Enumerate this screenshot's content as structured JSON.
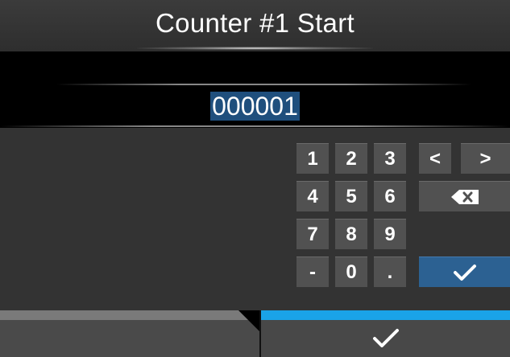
{
  "header": {
    "title": "Counter #1 Start"
  },
  "value": {
    "current": "000001"
  },
  "keypad": {
    "keys": {
      "k1": "1",
      "k2": "2",
      "k3": "3",
      "k4": "4",
      "k5": "5",
      "k6": "6",
      "k7": "7",
      "k8": "8",
      "k9": "9",
      "minus": "-",
      "k0": "0",
      "dot": ".",
      "left": "<",
      "right": ">"
    },
    "icons": {
      "backspace": "backspace-icon",
      "enter": "checkmark-icon"
    }
  },
  "footer": {
    "confirm_icon": "checkmark-icon",
    "accent_color": "#1aa3e8"
  },
  "colors": {
    "selection": "#1f4f7d",
    "enter_key": "#2c6192"
  }
}
